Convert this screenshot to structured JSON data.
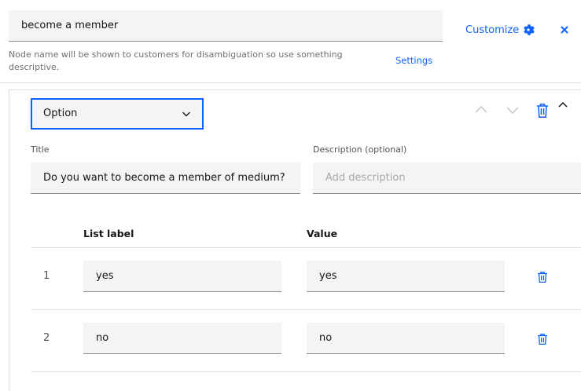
{
  "header": {
    "node_name": "become a member",
    "helper_text": "Node name will be shown to customers for disambiguation so use something descriptive.",
    "settings_link": "Settings",
    "customize_label": "Customize"
  },
  "response": {
    "type_select": "Option",
    "title_label": "Title",
    "title_value": "Do you want to become a member of medium?",
    "description_label": "Description (optional)",
    "description_placeholder": "Add description",
    "columns": {
      "list_label": "List label",
      "value": "Value"
    },
    "options": [
      {
        "index": "1",
        "label": "yes",
        "value": "yes"
      },
      {
        "index": "2",
        "label": "no",
        "value": "no"
      }
    ]
  },
  "colors": {
    "accent": "#0f62fe",
    "field_bg": "#f4f4f4",
    "divider": "#e0e0e0"
  },
  "icons": [
    "gear-icon",
    "close-icon",
    "chevron-down-icon",
    "arrow-up-icon",
    "arrow-down-icon",
    "trash-icon",
    "collapse-icon"
  ]
}
